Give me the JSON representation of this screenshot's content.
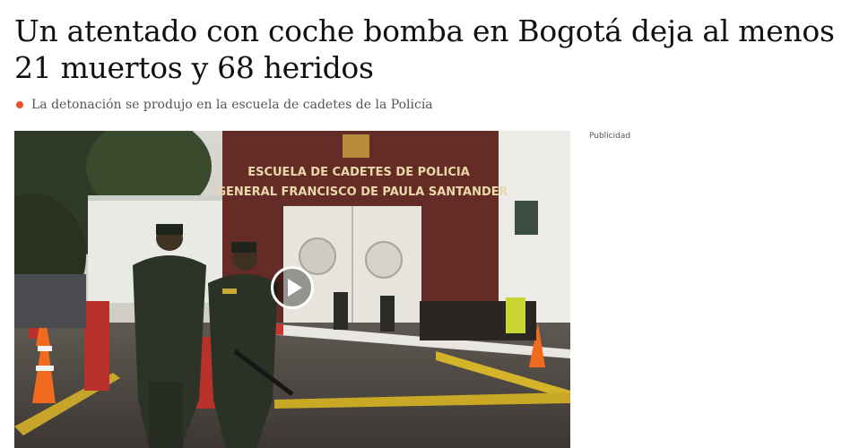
{
  "article": {
    "headline": "Un atentado con coche bomba en Bogotá deja al menos 21 muertos y 68 heridos",
    "subtitle": "La detonación se produjo en la escuela de cadetes de la Policía"
  },
  "media": {
    "sign_line_1": "ESCUELA DE CADETES DE POLICIA",
    "sign_line_2": "GENERAL FRANCISCO DE PAULA SANTANDER",
    "play_icon": "play-icon"
  },
  "sidebar": {
    "ad_label": "Publicidad"
  },
  "colors": {
    "bullet": "#e8512d",
    "headline": "#111111",
    "subtitle": "#555555"
  }
}
